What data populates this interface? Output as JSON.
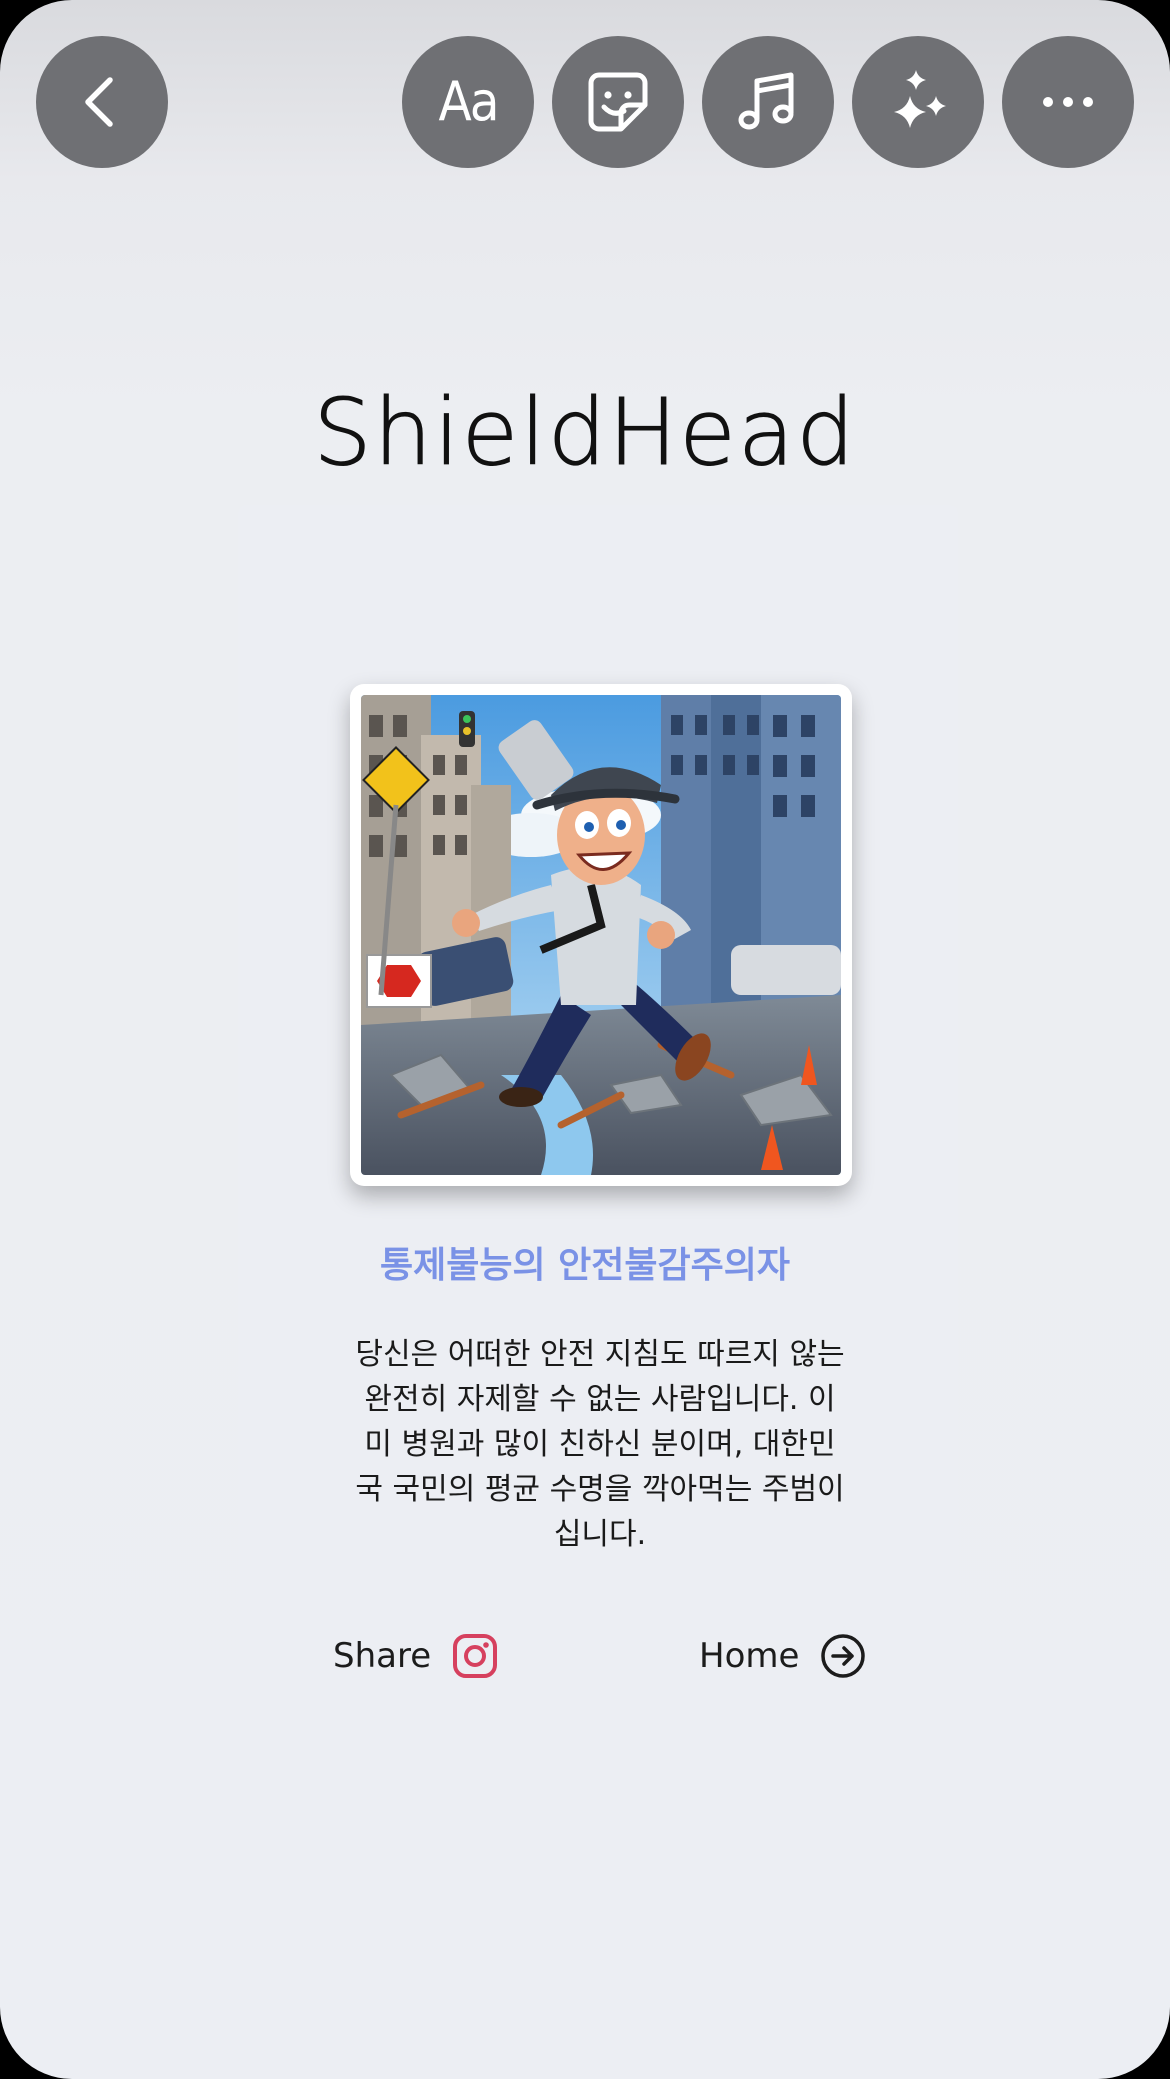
{
  "toolbar": {
    "back_icon": "chevron-left-icon",
    "text_tool_label": "Aa",
    "sticker_icon": "sticker-icon",
    "music_icon": "music-note-icon",
    "effects_icon": "sparkles-icon",
    "more_icon": "more-horizontal-icon"
  },
  "page": {
    "logo_text": "ShieldHead",
    "result_title": "통제불능의 안전불감주의자",
    "result_description": "당신은 어떠한 안전 지침도 따르지 않는 완전히 자제할 수 없는 사람입니다. 이미 병원과 많이 친하신 분이며, 대한민국 국민의 평균 수명을 깍아먹는 주범이십니다.",
    "share_label": "Share",
    "home_label": "Home"
  },
  "colors": {
    "toolbar_button": "#6f7074",
    "title_accent": "#7a92e6",
    "instagram_icon": "#d6405e"
  }
}
